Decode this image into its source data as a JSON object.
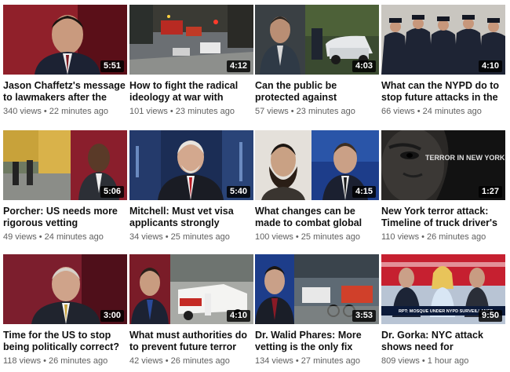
{
  "videos": [
    {
      "title": "Jason Chaffetz's message to lawmakers after the NYC",
      "views": "340 views",
      "age": "22 minutes ago",
      "duration": "5:51"
    },
    {
      "title": "How to fight the radical ideology at war with modern",
      "views": "101 views",
      "age": "23 minutes ago",
      "duration": "4:12"
    },
    {
      "title": "Can the public be protected against vehicular attacks?",
      "views": "57 views",
      "age": "23 minutes ago",
      "duration": "4:03"
    },
    {
      "title": "What can the NYPD do to stop future attacks in the",
      "views": "66 views",
      "age": "24 minutes ago",
      "duration": "4:10"
    },
    {
      "title": "Porcher: US needs more rigorous vetting",
      "views": "49 views",
      "age": "24 minutes ago",
      "duration": "5:06"
    },
    {
      "title": "Mitchell: Must vet visa applicants strongly",
      "views": "34 views",
      "age": "25 minutes ago",
      "duration": "5:40"
    },
    {
      "title": "What changes can be made to combat global terrorism?",
      "views": "100 views",
      "age": "25 minutes ago",
      "duration": "4:15"
    },
    {
      "title": "New York terror attack: Timeline of truck driver's",
      "views": "110 views",
      "age": "26 minutes ago",
      "duration": "1:27"
    },
    {
      "title": "Time for the US to stop being politically correct?",
      "views": "118 views",
      "age": "26 minutes ago",
      "duration": "3:00"
    },
    {
      "title": "What must authorities do to prevent future terror attacks?",
      "views": "42 views",
      "age": "26 minutes ago",
      "duration": "4:10"
    },
    {
      "title": "Dr. Walid Phares: More vetting is the only fix",
      "views": "134 views",
      "age": "27 minutes ago",
      "duration": "3:53"
    },
    {
      "title": "Dr. Gorka: NYC attack shows need for immigration reform",
      "views": "809 views",
      "age": "1 hour ago",
      "duration": "9:50"
    }
  ],
  "meta_separator": "•",
  "thumb_text": {
    "terror_banner": "TERROR IN NEW YORK CITY",
    "lower_third": "RPT: MOSQUE UNDER NYPD SURVEILLANCE"
  },
  "colors": {
    "duration_badge_bg": "#000000",
    "title_text": "#111111",
    "meta_text": "#606060",
    "fox_red": "#8a1420",
    "fox_blue": "#1d3d8a"
  }
}
